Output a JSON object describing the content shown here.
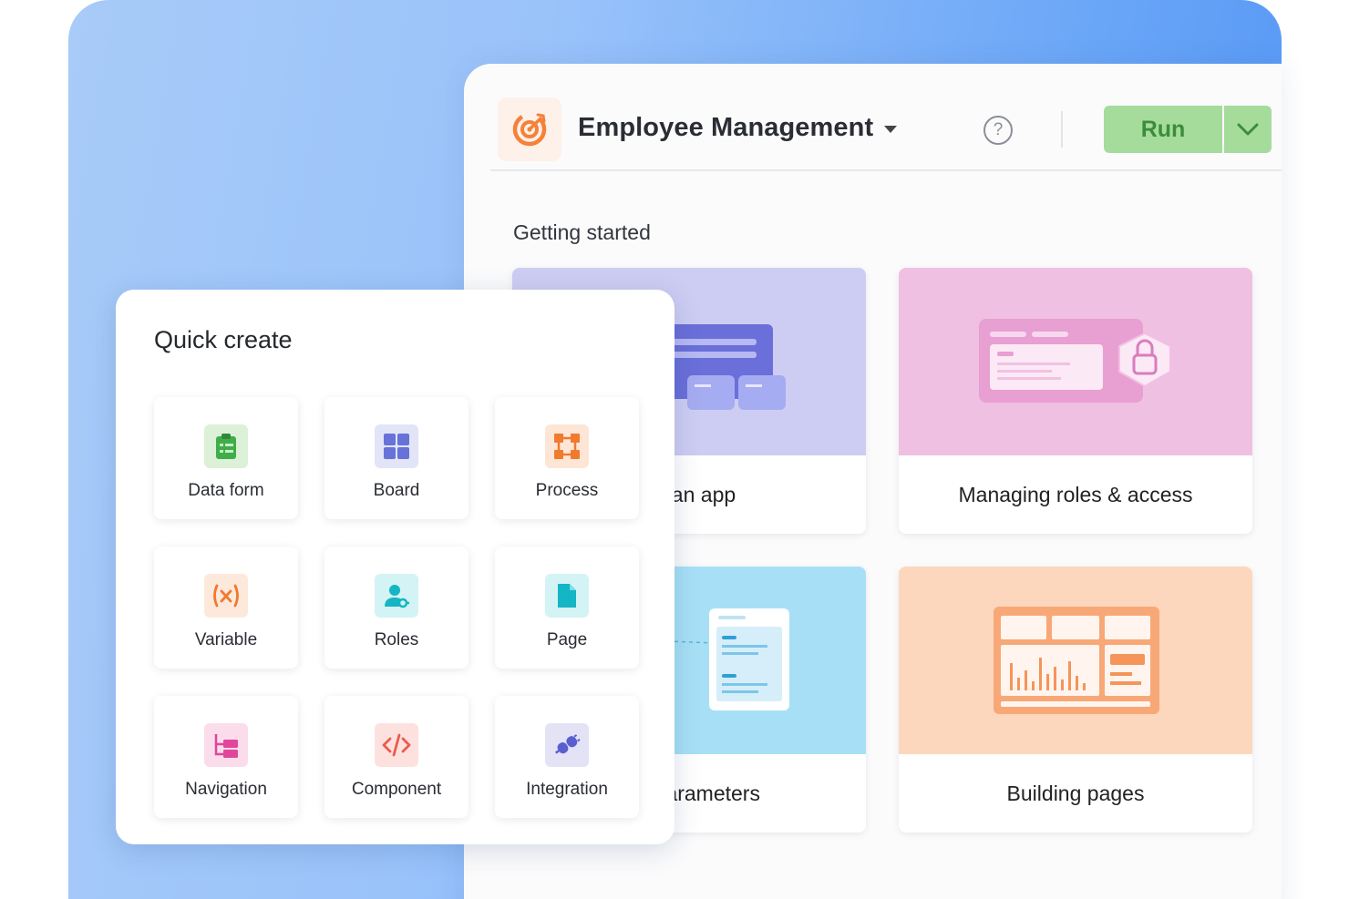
{
  "app": {
    "title": "Employee Management",
    "help_label": "?",
    "run_label": "Run"
  },
  "getting_started": {
    "heading": "Getting started",
    "cards": [
      {
        "label": "ng an app"
      },
      {
        "label": "Managing roles & access"
      },
      {
        "label": "s & parameters"
      },
      {
        "label": "Building pages"
      }
    ]
  },
  "quick_create": {
    "title": "Quick create",
    "items": [
      {
        "label": "Data form",
        "icon": "clipboard-icon",
        "bg": "#dcf1d8"
      },
      {
        "label": "Board",
        "icon": "board-grid-icon",
        "bg": "#e2e5f7"
      },
      {
        "label": "Process",
        "icon": "process-icon",
        "bg": "#fde6d6"
      },
      {
        "label": "Variable",
        "icon": "variable-icon",
        "bg": "#fde9dc"
      },
      {
        "label": "Roles",
        "icon": "roles-icon",
        "bg": "#d4f3f5"
      },
      {
        "label": "Page",
        "icon": "page-icon",
        "bg": "#d4f3f5"
      },
      {
        "label": "Navigation",
        "icon": "navigation-icon",
        "bg": "#fbdceb"
      },
      {
        "label": "Component",
        "icon": "code-icon",
        "bg": "#fde1df"
      },
      {
        "label": "Integration",
        "icon": "integration-icon",
        "bg": "#e4e3f6"
      }
    ]
  },
  "colors": {
    "accent_orange": "#f5813a",
    "run_green": "#a5dc9c",
    "board_indigo": "#6773d9"
  }
}
